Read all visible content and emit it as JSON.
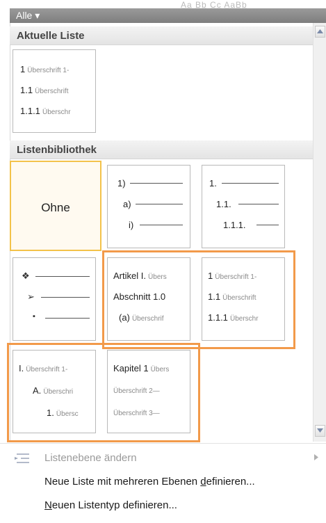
{
  "header": {
    "dropdown_label": "Alle ▾",
    "faded_text": "A̲a̲ B̲b̲ C̲c̲  A̲a̲B̲b̲"
  },
  "sections": {
    "current": "Aktuelle Liste",
    "library": "Listenbibliothek"
  },
  "current_list": {
    "lines": [
      {
        "num": "1",
        "text": "Überschrift 1-"
      },
      {
        "num": "1.1",
        "text": "Überschrift"
      },
      {
        "num": "1.1.1",
        "text": "Überschr"
      }
    ]
  },
  "library": {
    "none_label": "Ohne",
    "paren": {
      "l1": "1)",
      "l2": "a)",
      "l3": "i)"
    },
    "dotted": {
      "l1": "1.",
      "l2": "1.1.",
      "l3": "1.1.1."
    },
    "bullets": {
      "b1": "❖",
      "b2": "➢",
      "b3": "▪"
    },
    "article": {
      "l1a": "Artikel I.",
      "l1b": "Übers",
      "l2a": "Abschnitt 1.0",
      "l2b": "",
      "l3a": "(a)",
      "l3b": "Überschrif"
    },
    "headings": {
      "l1a": "1",
      "l1b": "Überschrift 1-",
      "l2a": "1.1",
      "l2b": "Überschrift",
      "l3a": "1.1.1",
      "l3b": "Überschr"
    },
    "roman": {
      "l1a": "I.",
      "l1b": "Überschrift 1-",
      "l2a": "A.",
      "l2b": "Überschri",
      "l3a": "1.",
      "l3b": "Übersc"
    },
    "chapter": {
      "l1a": "Kapitel 1",
      "l1b": "Übers",
      "l2": "Überschrift 2—",
      "l3": "Überschrift 3—"
    }
  },
  "menu": {
    "change_level": "Listenebene ändern",
    "define_multilevel_pre": "Neue Liste mit mehreren Ebenen ",
    "define_multilevel_ul": "d",
    "define_multilevel_post": "efinieren...",
    "define_style_ul": "N",
    "define_style_post": "euen Listentyp definieren..."
  },
  "colors": {
    "highlight": "#f29a4a",
    "selected_border": "#f3c24a"
  }
}
